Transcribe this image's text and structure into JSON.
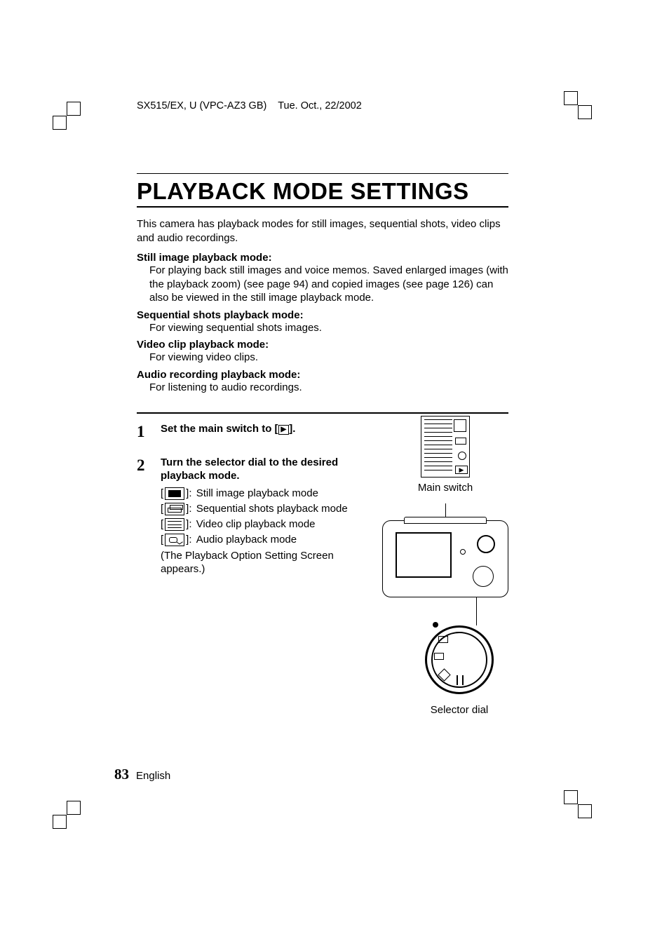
{
  "header": {
    "doc_id": "SX515/EX, U (VPC-AZ3 GB)",
    "date": "Tue. Oct., 22/2002"
  },
  "title": "PLAYBACK MODE SETTINGS",
  "intro": "This camera has playback modes for still images, sequential shots, video clips and audio recordings.",
  "modes": {
    "still": {
      "heading": "Still image playback mode:",
      "desc": "For playing back still images and voice memos. Saved enlarged images (with the playback zoom) (see page 94) and copied images (see page 126) can also be viewed in the still image playback mode."
    },
    "seq": {
      "heading": "Sequential shots playback mode:",
      "desc": "For viewing sequential shots images."
    },
    "video": {
      "heading": "Video clip playback mode:",
      "desc": "For viewing video clips."
    },
    "audio": {
      "heading": "Audio recording playback mode:",
      "desc": "For listening to audio recordings."
    }
  },
  "steps": {
    "s1": {
      "num": "1",
      "text_pre": "Set the main switch to [",
      "icon_glyph": "▶",
      "text_post": "]."
    },
    "s2": {
      "num": "2",
      "heading": "Turn the selector dial to the desired playback mode.",
      "items": {
        "still": "Still image playback mode",
        "seq": "Sequential shots playback mode",
        "video": "Video clip playback mode",
        "audio": "Audio playback mode"
      },
      "note": "(The Playback Option Setting Screen appears.)"
    }
  },
  "figure": {
    "main_switch_label": "Main switch",
    "selector_dial_label": "Selector dial",
    "switch_playback_glyph": "▶"
  },
  "footer": {
    "page": "83",
    "language": "English"
  }
}
